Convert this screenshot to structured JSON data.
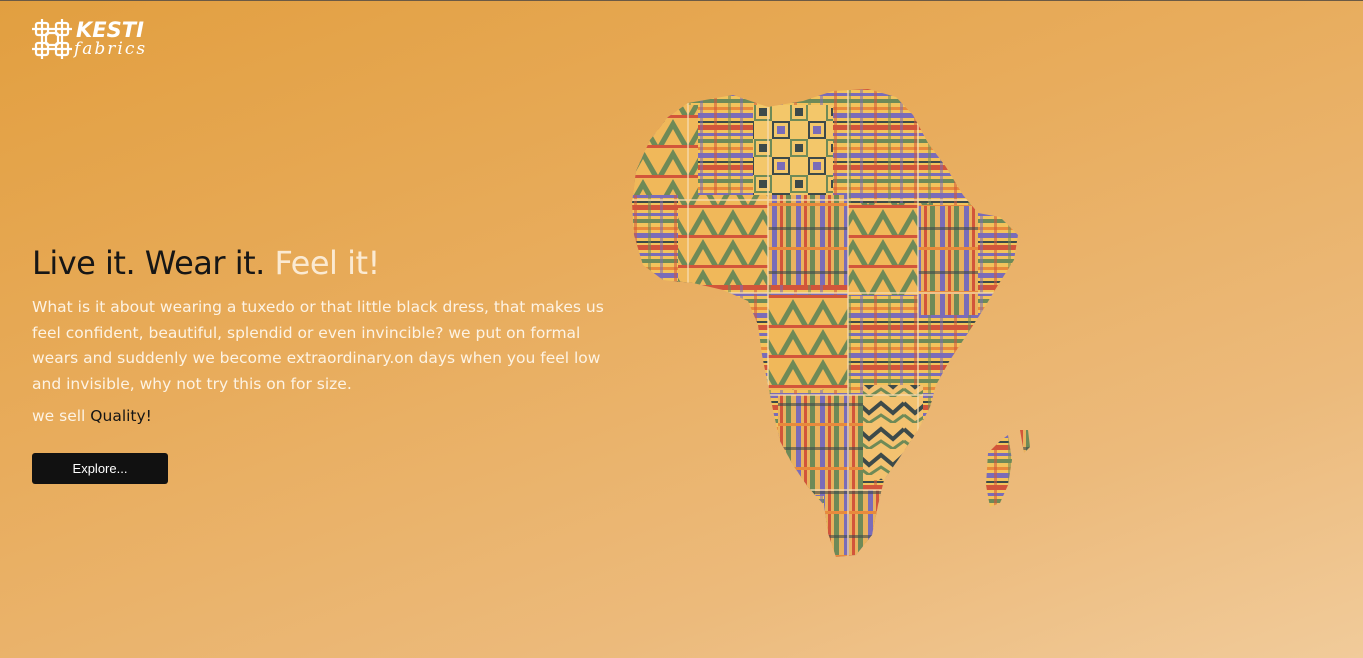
{
  "brand": {
    "name_primary": "KESTI",
    "name_secondary": "fabrics",
    "logo_icon": "woven-knot-icon"
  },
  "hero": {
    "headline_dark": "Live it. Wear it. ",
    "headline_accent": "Feel it!",
    "description": "What is it about wearing a tuxedo or that little black dress, that makes us feel confident, beautiful, splendid or even invincible? we put on formal wears and suddenly we become extraordinary.on days when you feel low and invisible, why not try this on for size.",
    "tagline_prefix": "we sell ",
    "tagline_emphasis": "Quality!",
    "cta_label": "Explore..."
  },
  "illustration": {
    "subject": "africa-map-kente-pattern"
  },
  "colors": {
    "background_start": "#e29f40",
    "background_end": "#f1cb9a",
    "headline_accent": "#fbead2",
    "button": "#111111",
    "kente_purple": "#7a6cb8",
    "kente_green": "#6e8a57",
    "kente_orange": "#e88a3c",
    "kente_red": "#d2553a",
    "kente_yellow": "#f2c35c",
    "kente_dark": "#3d4a4a"
  }
}
